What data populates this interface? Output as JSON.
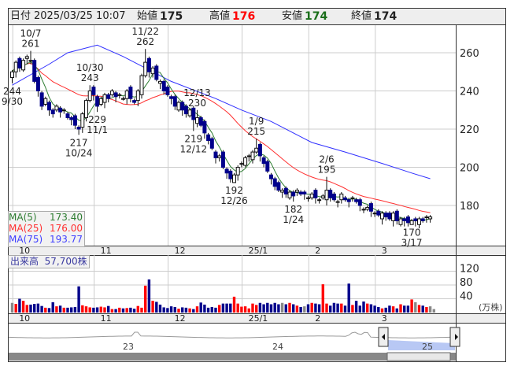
{
  "header": {
    "date_label": "日付",
    "datetime": "2025/03/25 10:07",
    "open_label": "始値",
    "open": "175",
    "high_label": "高値",
    "high": "176",
    "low_label": "安値",
    "low": "174",
    "close_label": "終値",
    "close": "174"
  },
  "legend": {
    "ma5_label": "MA(5)",
    "ma5": "173.40",
    "ma25_label": "MA(25)",
    "ma25": "176.00",
    "ma75_label": "MA(75)",
    "ma75": "193.77"
  },
  "volume_legend": {
    "label": "出来高",
    "value": "57,700株"
  },
  "colors": {
    "up": "#ff0000",
    "down": "#00008b",
    "flat": "#888888",
    "ma5": "#2e7d32",
    "ma25": "#ff3030",
    "ma75": "#3030ff",
    "nav_fill": "#b8c8f4"
  },
  "chart_data": {
    "type": "candlestick",
    "price_axis": {
      "ticks": [
        260,
        240,
        220,
        200,
        180
      ],
      "range": [
        159,
        275
      ]
    },
    "volume_axis": {
      "ticks": [
        120,
        80,
        40
      ],
      "unit": "(万株)",
      "range": [
        0,
        170
      ]
    },
    "month_ticks": [
      {
        "label": "10",
        "index": 1
      },
      {
        "label": "11",
        "index": 23
      },
      {
        "label": "12",
        "index": 43
      },
      {
        "label": "25/1",
        "index": 63
      },
      {
        "label": "2",
        "index": 81
      },
      {
        "label": "3",
        "index": 99
      }
    ],
    "closes": [
      250,
      255,
      252,
      256,
      258,
      256,
      245,
      240,
      232,
      236,
      230,
      228,
      232,
      229,
      230,
      226,
      225,
      222,
      220,
      228,
      235,
      240,
      238,
      232,
      236,
      238,
      236,
      240,
      237,
      238,
      236,
      240,
      236,
      234,
      240,
      248,
      255,
      250,
      252,
      246,
      245,
      240,
      238,
      236,
      232,
      234,
      230,
      228,
      230,
      225,
      226,
      222,
      218,
      214,
      210,
      205,
      206,
      200,
      197,
      194,
      196,
      200,
      202,
      205,
      206,
      208,
      210,
      206,
      202,
      198,
      194,
      190,
      188,
      188,
      186,
      187,
      185,
      188,
      186,
      186,
      184,
      186,
      184,
      183,
      185,
      188,
      184,
      183,
      182,
      186,
      183,
      182,
      184,
      182,
      180,
      178,
      179,
      177,
      176,
      175,
      176,
      174,
      173,
      176,
      172,
      173,
      172,
      171,
      172,
      172,
      173,
      172,
      174,
      174
    ],
    "volumes": [
      28,
      25,
      40,
      34,
      22,
      23,
      25,
      26,
      19,
      14,
      13,
      30,
      18,
      20,
      14,
      14,
      15,
      16,
      76,
      21,
      18,
      15,
      14,
      15,
      17,
      15,
      19,
      10,
      10,
      14,
      12,
      13,
      14,
      11,
      19,
      14,
      78,
      96,
      34,
      31,
      23,
      15,
      13,
      18,
      16,
      11,
      15,
      14,
      12,
      10,
      18,
      29,
      23,
      14,
      16,
      14,
      22,
      26,
      26,
      26,
      46,
      26,
      17,
      18,
      12,
      26,
      22,
      28,
      24,
      28,
      24,
      28,
      24,
      28,
      24,
      28,
      24,
      20,
      16,
      18,
      24,
      28,
      26,
      24,
      82,
      26,
      20,
      28,
      26,
      26,
      20,
      84,
      22,
      34,
      20,
      32,
      26,
      24,
      20,
      16,
      12,
      14,
      20,
      18,
      12,
      24,
      20,
      20,
      38,
      30,
      22,
      20,
      16,
      18,
      10
    ],
    "ma75_points": [
      [
        0,
        243
      ],
      [
        10,
        254
      ],
      [
        15,
        260
      ],
      [
        23,
        264
      ],
      [
        30,
        258
      ],
      [
        43,
        245
      ],
      [
        55,
        236
      ],
      [
        62,
        230
      ],
      [
        70,
        224
      ],
      [
        81,
        213
      ],
      [
        90,
        208
      ],
      [
        100,
        202
      ],
      [
        108,
        197
      ],
      [
        113,
        194
      ]
    ],
    "annotations": [
      {
        "index": 0,
        "value": "244",
        "date": "9/30",
        "kind": "low",
        "price": 244
      },
      {
        "index": 5,
        "value": "261",
        "date": "10/7",
        "kind": "high",
        "price": 261
      },
      {
        "index": 18,
        "value": "217",
        "date": "10/24",
        "kind": "low",
        "price": 217
      },
      {
        "index": 21,
        "value": "243",
        "date": "10/30",
        "kind": "high",
        "price": 243
      },
      {
        "index": 23,
        "value": "229",
        "date": "11/1",
        "kind": "low",
        "price": 229
      },
      {
        "index": 36,
        "value": "262",
        "date": "11/22",
        "kind": "high",
        "price": 262
      },
      {
        "index": 50,
        "value": "230",
        "date": "12/13",
        "kind": "high",
        "price": 230
      },
      {
        "index": 49,
        "value": "219",
        "date": "12/12",
        "kind": "low",
        "price": 219
      },
      {
        "index": 60,
        "value": "192",
        "date": "12/26",
        "kind": "low",
        "price": 192
      },
      {
        "index": 66,
        "value": "215",
        "date": "1/9",
        "kind": "high",
        "price": 215
      },
      {
        "index": 76,
        "value": "182",
        "date": "1/24",
        "kind": "low",
        "price": 182
      },
      {
        "index": 85,
        "value": "195",
        "date": "2/6",
        "kind": "high",
        "price": 195
      },
      {
        "index": 108,
        "value": "170",
        "date": "3/17",
        "kind": "low",
        "price": 170
      }
    ],
    "navigator": {
      "labels": [
        "23",
        "24",
        "25"
      ]
    }
  }
}
